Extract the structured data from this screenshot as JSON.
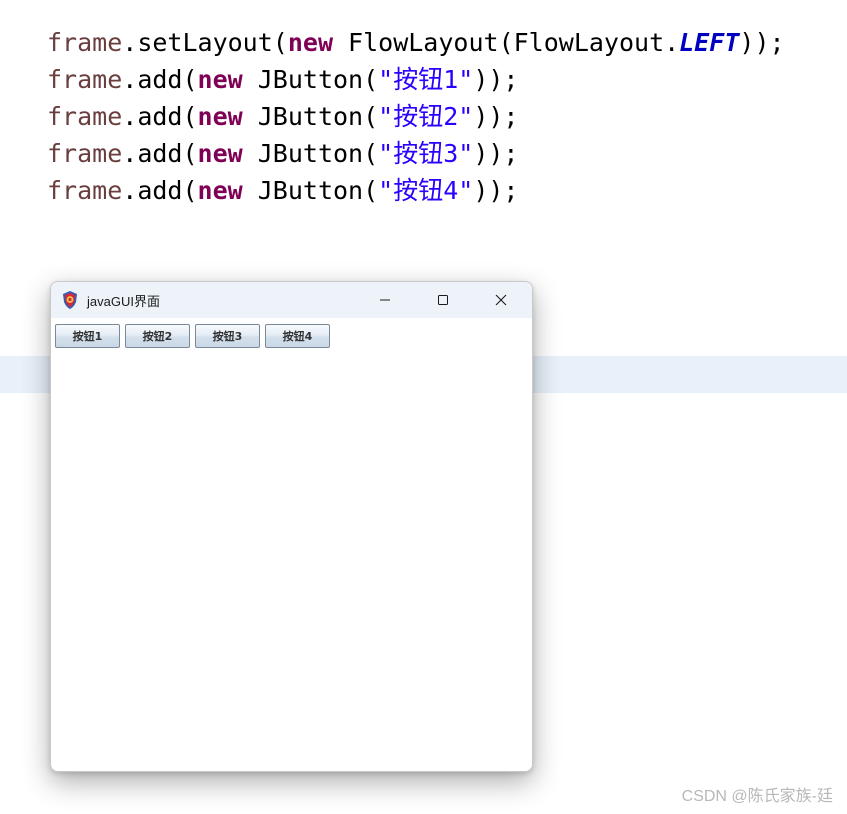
{
  "code_lines": [
    [
      {
        "t": "frame",
        "c": "field"
      },
      {
        "t": ".setLayout(",
        "c": "plain"
      },
      {
        "t": "new",
        "c": "kw"
      },
      {
        "t": " FlowLayout(FlowLayout.",
        "c": "plain"
      },
      {
        "t": "LEFT",
        "c": "const"
      },
      {
        "t": "));",
        "c": "plain"
      }
    ],
    [
      {
        "t": "frame",
        "c": "field"
      },
      {
        "t": ".add(",
        "c": "plain"
      },
      {
        "t": "new",
        "c": "kw"
      },
      {
        "t": " JButton(",
        "c": "plain"
      },
      {
        "t": "\"按钮1\"",
        "c": "str"
      },
      {
        "t": "));",
        "c": "plain"
      }
    ],
    [
      {
        "t": "frame",
        "c": "field"
      },
      {
        "t": ".add(",
        "c": "plain"
      },
      {
        "t": "new",
        "c": "kw"
      },
      {
        "t": " JButton(",
        "c": "plain"
      },
      {
        "t": "\"按钮2\"",
        "c": "str"
      },
      {
        "t": "));",
        "c": "plain"
      }
    ],
    [
      {
        "t": "frame",
        "c": "field"
      },
      {
        "t": ".add(",
        "c": "plain"
      },
      {
        "t": "new",
        "c": "kw"
      },
      {
        "t": " JButton(",
        "c": "plain"
      },
      {
        "t": "\"按钮3\"",
        "c": "str"
      },
      {
        "t": "));",
        "c": "plain"
      }
    ],
    [
      {
        "t": "frame",
        "c": "field"
      },
      {
        "t": ".add(",
        "c": "plain"
      },
      {
        "t": "new",
        "c": "kw"
      },
      {
        "t": " JButton(",
        "c": "plain"
      },
      {
        "t": "\"按钮4\"",
        "c": "str"
      },
      {
        "t": "));",
        "c": "plain"
      }
    ]
  ],
  "colors": {
    "field": "#6a3e3e",
    "keyword": "#7f0055",
    "string": "#2a00ff",
    "constant": "#0000c0",
    "highlight_line": "#e8f0fa",
    "titlebar": "#eef3fa"
  },
  "window": {
    "title": "javaGUI界面",
    "icon": "java-app-icon",
    "controls": {
      "minimize": "minimize-icon",
      "maximize": "maximize-icon",
      "close": "close-icon"
    },
    "buttons": [
      {
        "label": "按钮1"
      },
      {
        "label": "按钮2"
      },
      {
        "label": "按钮3"
      },
      {
        "label": "按钮4"
      }
    ]
  },
  "watermark": "CSDN @陈氏家族-廷"
}
